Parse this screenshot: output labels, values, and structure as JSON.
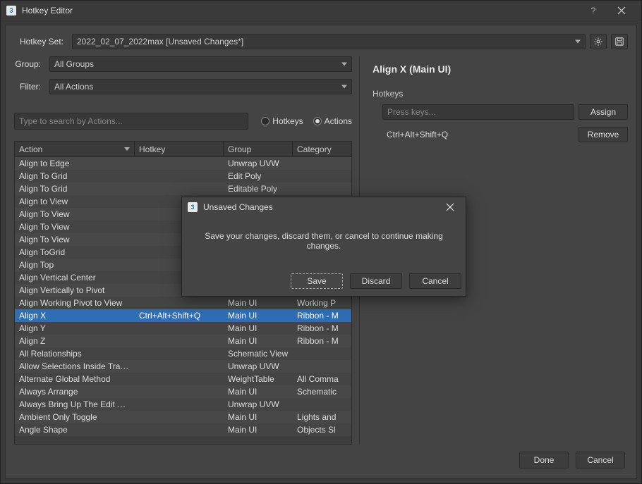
{
  "window": {
    "title": "Hotkey Editor",
    "help": "?",
    "close": "✕"
  },
  "hotkeySet": {
    "label": "Hotkey Set:",
    "value": "2022_02_07_2022max [Unsaved Changes*]"
  },
  "group": {
    "label": "Group:",
    "value": "All Groups"
  },
  "filter": {
    "label": "Filter:",
    "value": "All Actions"
  },
  "search": {
    "placeholder": "Type to search by Actions..."
  },
  "radios": {
    "hotkeys": "Hotkeys",
    "actions": "Actions",
    "selected": "actions"
  },
  "columns": {
    "action": "Action",
    "hotkey": "Hotkey",
    "group": "Group",
    "category": "Category"
  },
  "rows": [
    {
      "action": "Align to Edge",
      "hotkey": "",
      "group": "Unwrap UVW",
      "category": ""
    },
    {
      "action": "Align To Grid",
      "hotkey": "",
      "group": "Edit Poly",
      "category": ""
    },
    {
      "action": "Align To Grid",
      "hotkey": "",
      "group": "Editable Poly",
      "category": ""
    },
    {
      "action": "Align to View",
      "hotkey": "",
      "group": "",
      "category": ""
    },
    {
      "action": "Align To View",
      "hotkey": "",
      "group": "",
      "category": ""
    },
    {
      "action": "Align To View",
      "hotkey": "",
      "group": "",
      "category": ""
    },
    {
      "action": "Align To View",
      "hotkey": "",
      "group": "",
      "category": ""
    },
    {
      "action": "Align ToGrid",
      "hotkey": "",
      "group": "",
      "category": ""
    },
    {
      "action": "Align Top",
      "hotkey": "",
      "group": "",
      "category": ""
    },
    {
      "action": "Align Vertical Center",
      "hotkey": "",
      "group": "",
      "category": ""
    },
    {
      "action": "Align Vertically to Pivot",
      "hotkey": "",
      "group": "",
      "category": ""
    },
    {
      "action": "Align Working Pivot to View",
      "hotkey": "",
      "group": "Main UI",
      "category": "Working P"
    },
    {
      "action": "Align X",
      "hotkey": "Ctrl+Alt+Shift+Q",
      "group": "Main UI",
      "category": "Ribbon - M",
      "selected": true
    },
    {
      "action": "Align Y",
      "hotkey": "",
      "group": "Main UI",
      "category": "Ribbon - M"
    },
    {
      "action": "Align Z",
      "hotkey": "",
      "group": "Main UI",
      "category": "Ribbon - M"
    },
    {
      "action": "All Relationships",
      "hotkey": "",
      "group": "Schematic View",
      "category": ""
    },
    {
      "action": "Allow Selections Inside Tranform ...",
      "hotkey": "",
      "group": "Unwrap UVW",
      "category": ""
    },
    {
      "action": "Alternate Global Method",
      "hotkey": "",
      "group": "WeightTable",
      "category": "All Comma"
    },
    {
      "action": "Always Arrange",
      "hotkey": "",
      "group": "Main UI",
      "category": "Schematic"
    },
    {
      "action": "Always Bring Up The Edit Window",
      "hotkey": "",
      "group": "Unwrap UVW",
      "category": ""
    },
    {
      "action": "Ambient Only Toggle",
      "hotkey": "",
      "group": "Main UI",
      "category": "Lights and"
    },
    {
      "action": "Angle Shape",
      "hotkey": "",
      "group": "Main UI",
      "category": "Objects Sl"
    }
  ],
  "detail": {
    "title": "Align X (Main UI)",
    "sectionLabel": "Hotkeys",
    "pressPlaceholder": "Press keys...",
    "assignLabel": "Assign",
    "removeLabel": "Remove",
    "assigned": [
      "Ctrl+Alt+Shift+Q"
    ]
  },
  "footer": {
    "done": "Done",
    "cancel": "Cancel"
  },
  "modal": {
    "title": "Unsaved Changes",
    "message": "Save your changes, discard them, or cancel to continue making changes.",
    "save": "Save",
    "discard": "Discard",
    "cancel": "Cancel"
  }
}
